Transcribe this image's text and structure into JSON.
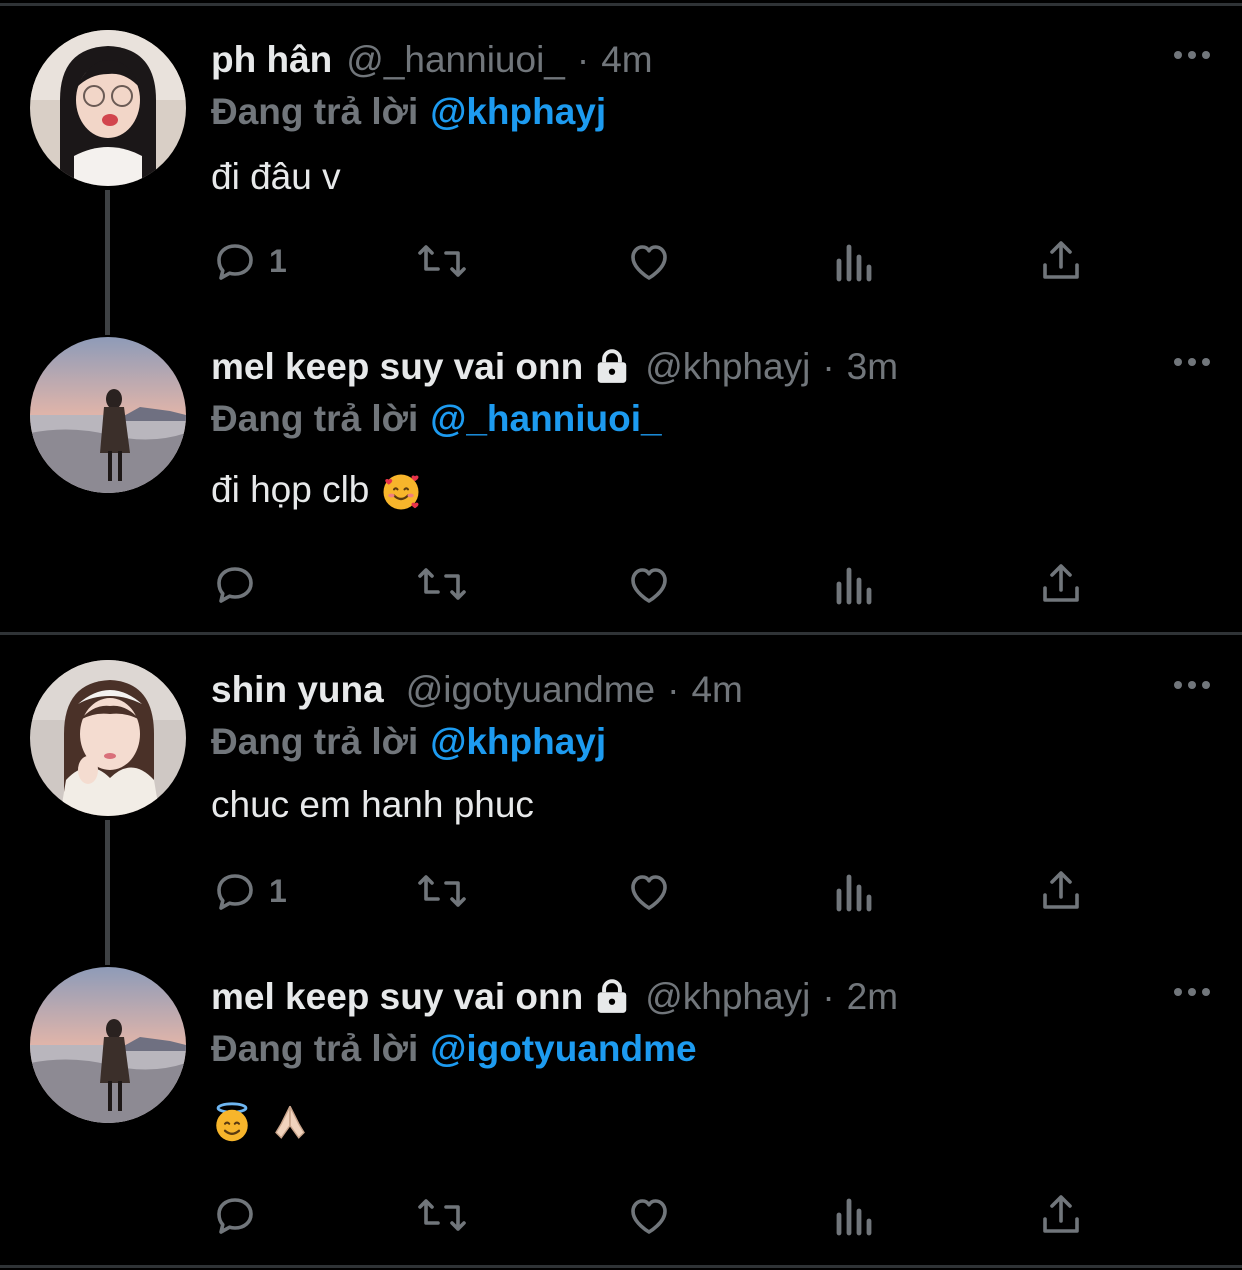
{
  "threads": [
    {
      "tweets": [
        {
          "name": "ph hân",
          "handle": "@_hanniuoi_",
          "separator": "·",
          "time": "4m",
          "reply_prefix": "Đang trả lời",
          "reply_target": "@khphayj",
          "text": "đi đâu v",
          "reply_count": "1",
          "avatar_icon": "avatar-girl-glasses"
        },
        {
          "name": "mel keep suy vai onn",
          "handle": "@khphayj",
          "separator": "·",
          "time": "3m",
          "reply_prefix": "Đang trả lời",
          "reply_target": "@_hanniuoi_",
          "text": "đi họp clb",
          "reply_count": "",
          "avatar_icon": "avatar-beach-sunset"
        }
      ]
    },
    {
      "tweets": [
        {
          "name": "shin yuna",
          "handle": "@igotyuandme",
          "separator": "·",
          "time": "4m",
          "reply_prefix": "Đang trả lời",
          "reply_target": "@khphayj",
          "text": "chuc em hanh phuc",
          "reply_count": "1",
          "avatar_icon": "avatar-girl-headband"
        },
        {
          "name": "mel keep suy vai onn",
          "handle": "@khphayj",
          "separator": "·",
          "time": "2m",
          "reply_prefix": "Đang trả lời",
          "reply_target": "@igotyuandme",
          "text": "",
          "reply_count": "",
          "avatar_icon": "avatar-beach-sunset"
        }
      ]
    }
  ],
  "colors": {
    "background": "#000000",
    "primary_text": "#e7e9ea",
    "secondary_text": "#71767b",
    "accent": "#1d9bf0",
    "divider": "#2f3336"
  }
}
